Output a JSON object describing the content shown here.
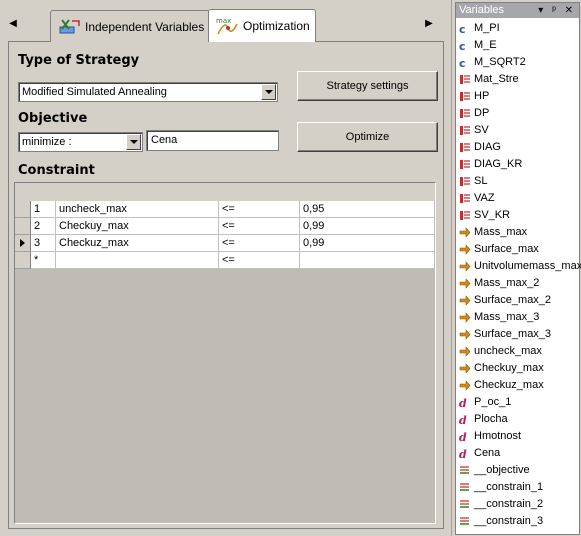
{
  "tabs": [
    {
      "label": "Independent Variables",
      "icon": "independent-variables-icon"
    },
    {
      "label": "Optimization",
      "icon": "optimization-icon",
      "active": true
    }
  ],
  "strategy": {
    "title": "Type of Strategy",
    "selected": "Modified Simulated Annealing",
    "settings_button": "Strategy settings"
  },
  "objective": {
    "title": "Objective",
    "mode": "minimize :",
    "value": "Cena",
    "optimize_button": "Optimize"
  },
  "constraint": {
    "title": "Constraint",
    "rows": [
      {
        "num": "1",
        "name": "uncheck_max",
        "op": "<=",
        "value": "0,95",
        "current": false
      },
      {
        "num": "2",
        "name": "Checkuy_max",
        "op": "<=",
        "value": "0,99",
        "current": false
      },
      {
        "num": "3",
        "name": "Checkuz_max",
        "op": "<=",
        "value": "0,99",
        "current": true
      },
      {
        "num": "*",
        "name": "",
        "op": "<=",
        "value": "",
        "current": false
      }
    ]
  },
  "variables_panel": {
    "title": "Variables",
    "header_icons": "▾ ᵖ ✕",
    "items": [
      {
        "name": "M_PI",
        "kind": "constant"
      },
      {
        "name": "M_E",
        "kind": "constant"
      },
      {
        "name": "M_SQRT2",
        "kind": "constant"
      },
      {
        "name": "Mat_Stre",
        "kind": "table"
      },
      {
        "name": "HP",
        "kind": "table"
      },
      {
        "name": "DP",
        "kind": "table"
      },
      {
        "name": "SV",
        "kind": "table"
      },
      {
        "name": "DIAG",
        "kind": "table"
      },
      {
        "name": "DIAG_KR",
        "kind": "table"
      },
      {
        "name": "SL",
        "kind": "table"
      },
      {
        "name": "VAZ",
        "kind": "table"
      },
      {
        "name": "SV_KR",
        "kind": "table"
      },
      {
        "name": "Mass_max",
        "kind": "output"
      },
      {
        "name": "Surface_max",
        "kind": "output"
      },
      {
        "name": "Unitvolumemass_max",
        "kind": "output"
      },
      {
        "name": "Mass_max_2",
        "kind": "output"
      },
      {
        "name": "Surface_max_2",
        "kind": "output"
      },
      {
        "name": "Mass_max_3",
        "kind": "output"
      },
      {
        "name": "Surface_max_3",
        "kind": "output"
      },
      {
        "name": "uncheck_max",
        "kind": "output"
      },
      {
        "name": "Checkuy_max",
        "kind": "output"
      },
      {
        "name": "Checkuz_max",
        "kind": "output"
      },
      {
        "name": "P_oc_1",
        "kind": "derived"
      },
      {
        "name": "Plocha",
        "kind": "derived"
      },
      {
        "name": "Hmotnost",
        "kind": "derived"
      },
      {
        "name": "Cena",
        "kind": "derived"
      },
      {
        "name": "__objective",
        "kind": "objective"
      },
      {
        "name": "__constrain_1",
        "kind": "objective"
      },
      {
        "name": "__constrain_2",
        "kind": "objective"
      },
      {
        "name": "__constrain_3",
        "kind": "objective"
      }
    ]
  },
  "colors": {
    "constant": "#3355aa",
    "table": "#c03030",
    "output": "#d08a1c",
    "derived": "#b02060",
    "objective": "#2e7d32"
  }
}
